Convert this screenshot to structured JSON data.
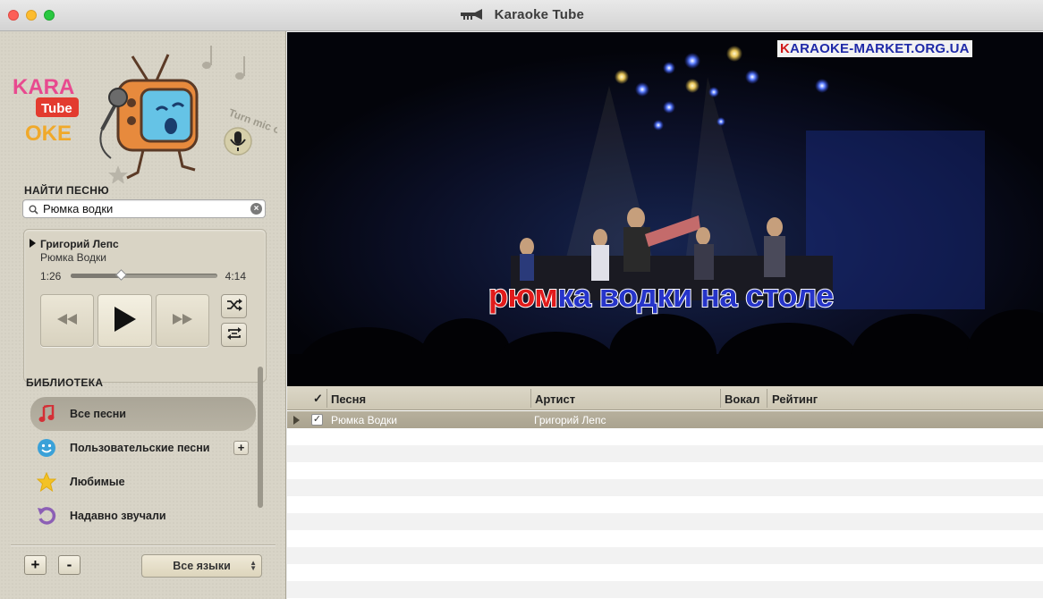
{
  "window": {
    "title": "Karaoke Tube"
  },
  "logo": {
    "kara": "KARA",
    "oke": "OKE",
    "tube": "Tube",
    "mic_prompt": "Turn mic on"
  },
  "search": {
    "heading": "НАЙТИ ПЕСНЮ",
    "value": "Рюмка водки"
  },
  "now_playing": {
    "artist": "Григорий Лепс",
    "song": "Рюмка Водки",
    "time_current": "1:26",
    "time_total": "4:14",
    "progress": 0.34
  },
  "library": {
    "heading": "БИБЛИОТЕКА",
    "items": [
      {
        "label": "Все песни",
        "icon": "music-note-icon",
        "selected": true
      },
      {
        "label": "Пользовательские песни",
        "icon": "smiley-icon",
        "selected": false,
        "add": "+"
      },
      {
        "label": "Любимые",
        "icon": "star-icon",
        "selected": false
      },
      {
        "label": "Надавно звучали",
        "icon": "history-icon",
        "selected": false
      }
    ]
  },
  "bottom_bar": {
    "add": "+",
    "remove": "-",
    "language": "Все языки"
  },
  "video": {
    "watermark_red": "K",
    "watermark_rest": "ARAOKE-MARKET.ORG.UA",
    "lyrics_sung": "рюм",
    "lyrics_rest": "ка водки на столе"
  },
  "table": {
    "columns": [
      "✓",
      "Песня",
      "Артист",
      "Вокал",
      "Рейтинг"
    ],
    "rows": [
      {
        "checked": "✓",
        "song": "Рюмка Водки",
        "artist": "Григорий Лепс",
        "vocal": "",
        "rating": ""
      }
    ]
  },
  "colors": {
    "sidebar_bg": "#d8d4c7",
    "selected_row": "#aaa38f",
    "lyrics_blue": "#2634c9",
    "lyrics_red": "#e11b1b",
    "watermark_blue": "#1f2aa8"
  }
}
